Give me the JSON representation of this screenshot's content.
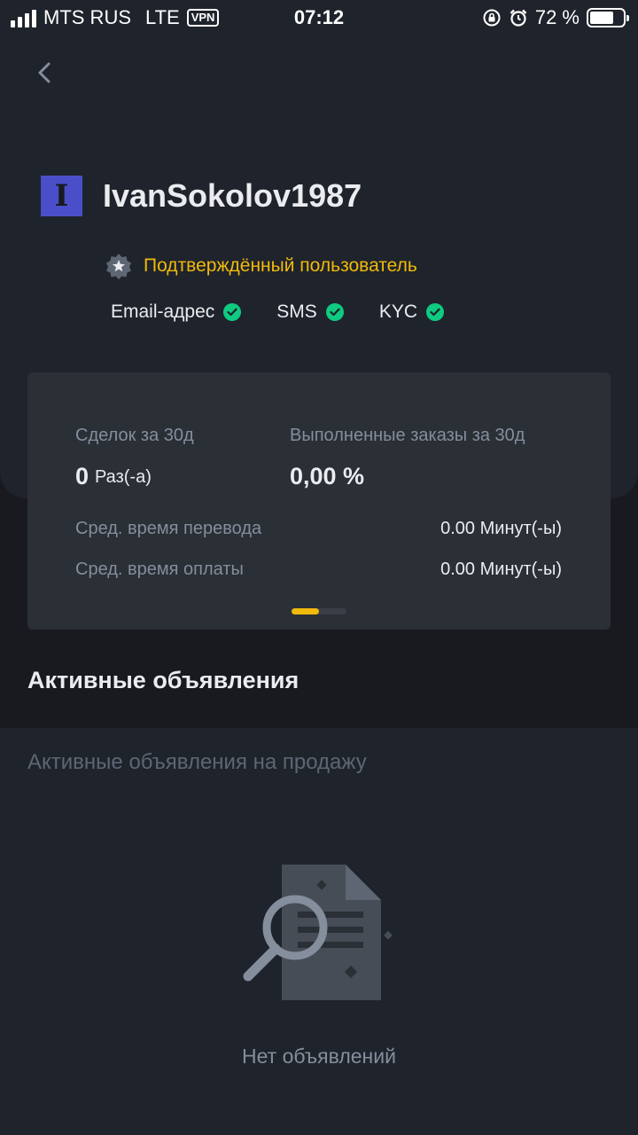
{
  "status_bar": {
    "carrier": "MTS RUS",
    "network": "LTE",
    "vpn": "VPN",
    "time": "07:12",
    "battery_percent_text": "72 %",
    "battery_level": 0.72
  },
  "profile": {
    "avatar_letter": "I",
    "username": "IvanSokolov1987",
    "verified_label": "Подтверждённый пользователь",
    "verifications": [
      {
        "label": "Email-адрес",
        "verified": true
      },
      {
        "label": "SMS",
        "verified": true
      },
      {
        "label": "KYC",
        "verified": true
      }
    ]
  },
  "stats": {
    "trades_label": "Сделок за 30д",
    "trades_value": "0",
    "trades_unit": "Раз(-а)",
    "completion_label": "Выполненные заказы за 30д",
    "completion_value": "0,00 %",
    "rows": [
      {
        "label": "Сред. время перевода",
        "value": "0.00 Минут(-ы)"
      },
      {
        "label": "Сред. время оплаты",
        "value": "0.00 Минут(-ы)"
      }
    ],
    "page_index": 1,
    "page_count": 2
  },
  "ads": {
    "section_title": "Активные объявления",
    "subtitle": "Активные объявления на продажу",
    "empty_text": "Нет объявлений"
  },
  "colors": {
    "accent": "#f0b90b",
    "success": "#0ecb81",
    "background": "#181a20",
    "card": "#2b2f36"
  }
}
